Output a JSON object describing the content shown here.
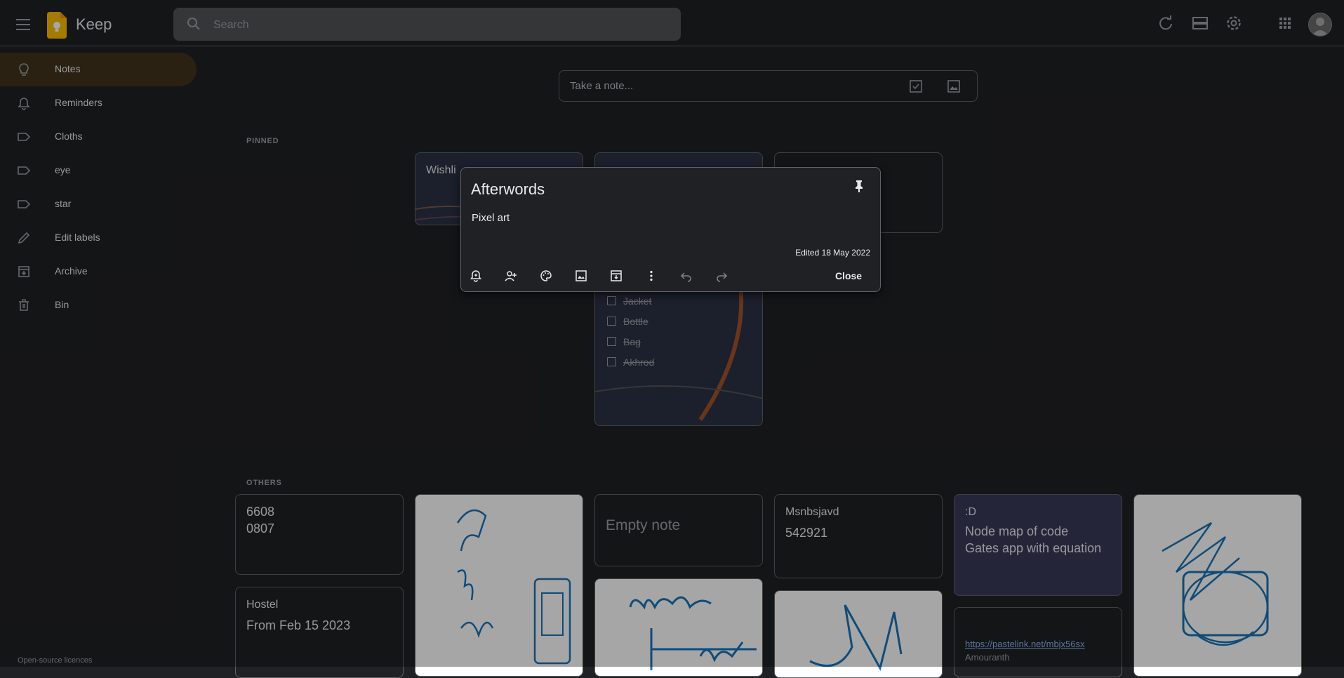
{
  "header": {
    "app_name": "Keep",
    "search_placeholder": "Search",
    "icons": [
      "menu-icon",
      "keep-logo",
      "search-icon",
      "refresh-icon",
      "list-view-icon",
      "settings-icon",
      "apps-icon",
      "account-avatar"
    ]
  },
  "sidebar": {
    "items": [
      {
        "label": "Notes",
        "icon": "lightbulb-icon",
        "active": true
      },
      {
        "label": "Reminders",
        "icon": "bell-icon"
      },
      {
        "label": "Cloths",
        "icon": "label-icon"
      },
      {
        "label": "eye",
        "icon": "label-icon"
      },
      {
        "label": "star",
        "icon": "label-icon"
      },
      {
        "label": "Edit labels",
        "icon": "pencil-icon"
      },
      {
        "label": "Archive",
        "icon": "archive-icon"
      },
      {
        "label": "Bin",
        "icon": "trash-icon"
      }
    ],
    "footer": "Open-source licences"
  },
  "take_note": {
    "placeholder": "Take a note..."
  },
  "sections": {
    "pinned": "PINNED",
    "others": "OTHERS"
  },
  "pinned_cards": {
    "wishlist_title": "Wishli",
    "checklist": [
      "Jacket",
      "Bottle",
      "Bag",
      "Akhrod"
    ]
  },
  "other_cards": {
    "numbers": [
      "6608",
      "0807"
    ],
    "hostel_title": "Hostel",
    "hostel_body": "From Feb 15 2023",
    "empty": "Empty note",
    "msn_title": "Msnbsjavd",
    "msn_body": "542921",
    "d_title": ":D",
    "d_body1": "Node map of code",
    "d_body2": "Gates app with equation",
    "link": "https://pastelink.net/mbjx56sx",
    "link_sub": "Amouranth"
  },
  "modal": {
    "title": "Afterwords",
    "body": "Pixel art",
    "edited": "Edited 18 May 2022",
    "close_label": "Close",
    "toolbar": [
      "reminder-icon",
      "collaborator-icon",
      "palette-icon",
      "add-image-icon",
      "archive-icon",
      "more-icon",
      "undo-icon",
      "redo-icon"
    ]
  },
  "colors": {
    "background": "#202124",
    "border": "#5f6368",
    "active_nav": "#41331c",
    "logo": "#fbbc04",
    "link": "#8ab4f8",
    "sketch": "#1a73b8"
  }
}
